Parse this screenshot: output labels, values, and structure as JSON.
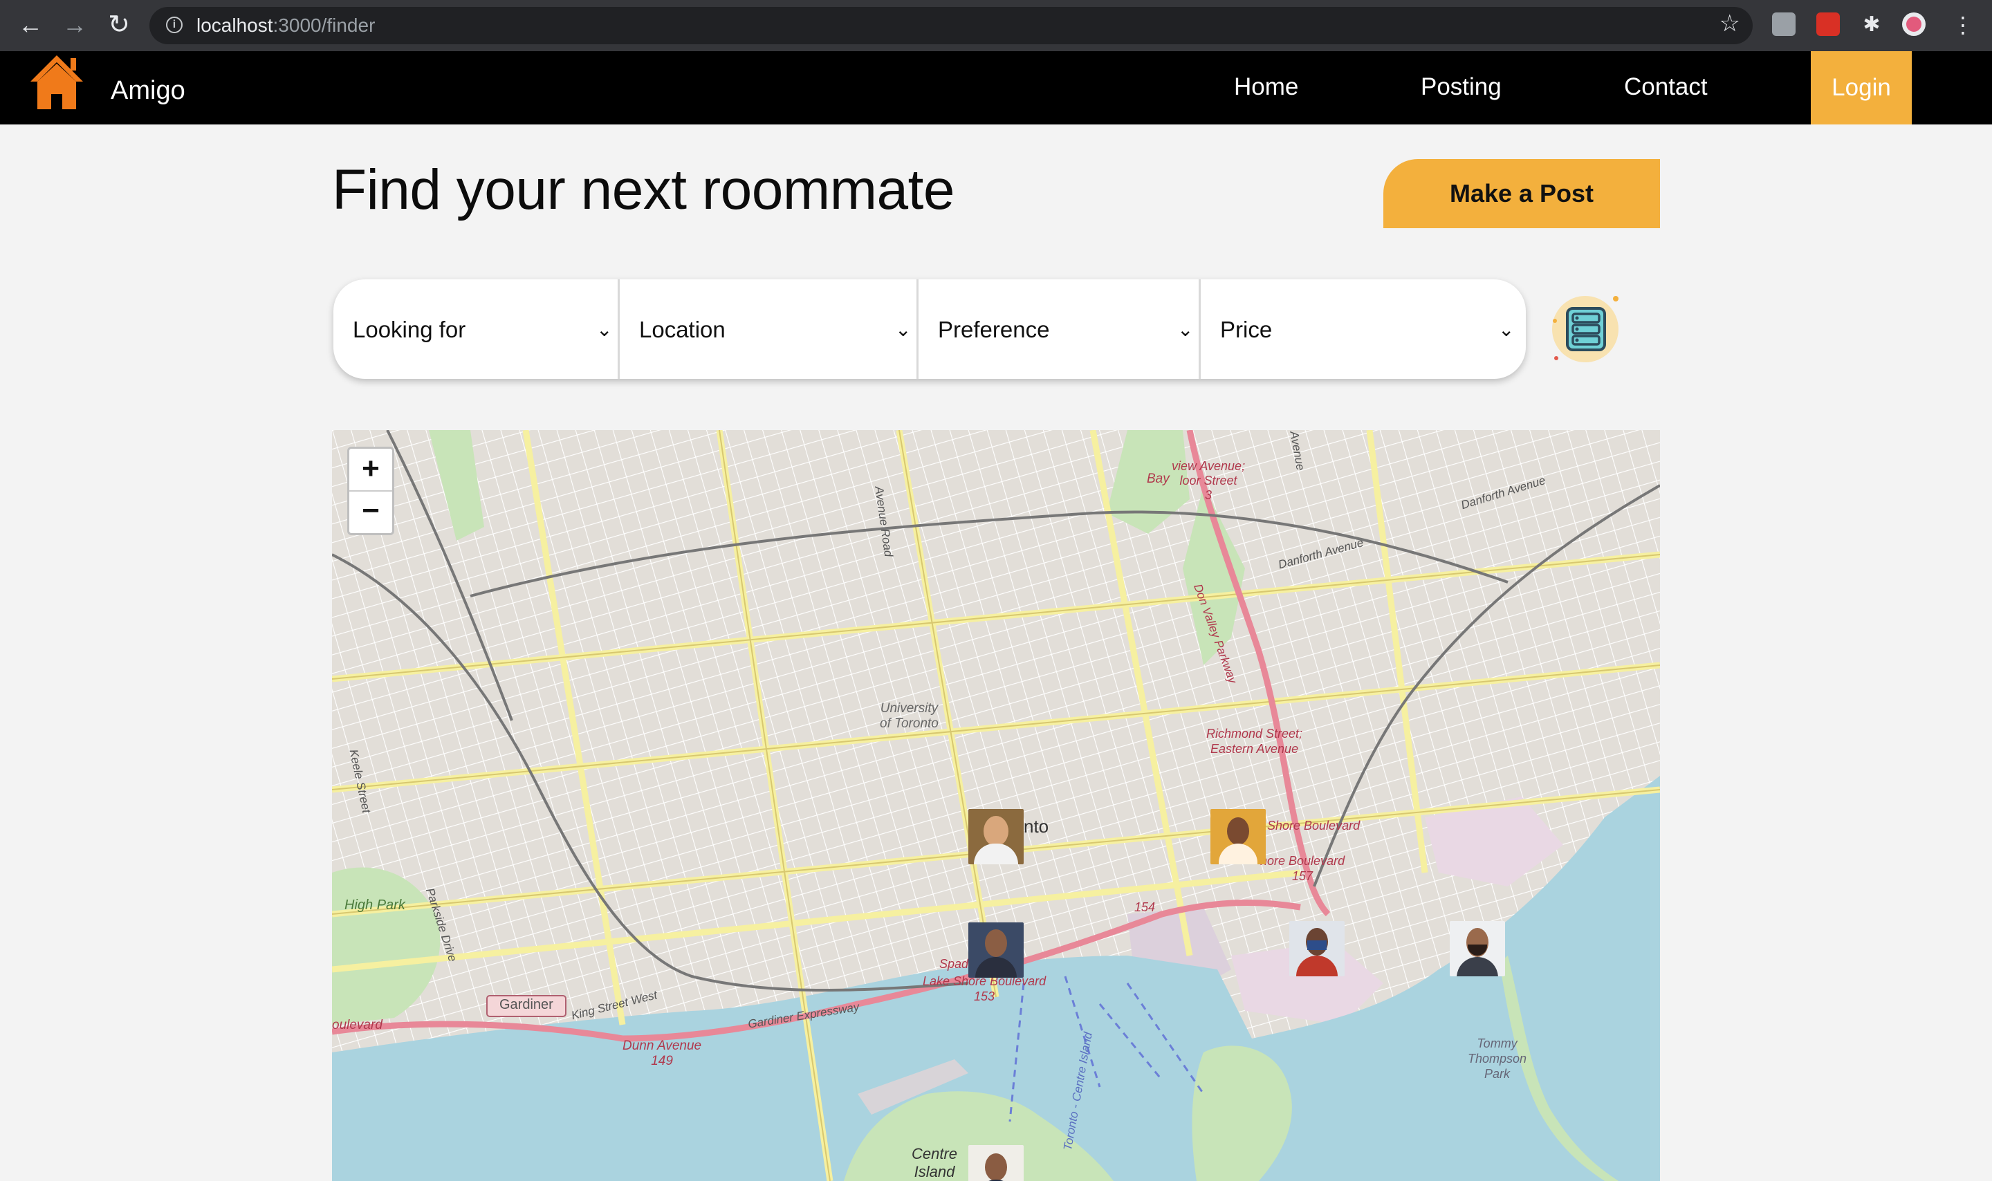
{
  "browser": {
    "url_host": "localhost",
    "url_path": ":3000/finder"
  },
  "navbar": {
    "brand": "Amigo",
    "links": [
      "Home",
      "Posting",
      "Contact"
    ],
    "login_label": "Login",
    "accent_color": "#f3b03d"
  },
  "header": {
    "title": "Find your next roommate",
    "make_post_label": "Make a Post"
  },
  "filters": [
    {
      "label": "Looking for"
    },
    {
      "label": "Location"
    },
    {
      "label": "Preference"
    },
    {
      "label": "Price"
    }
  ],
  "map": {
    "zoom_in": "+",
    "zoom_out": "−",
    "labels": {
      "university": "University of Toronto",
      "university_l1": "University",
      "university_l2": "of Toronto",
      "toronto": "nto",
      "high_park": "High Park",
      "keele": "Keele Street",
      "parkside": "Parkside Drive",
      "king": "King Street West",
      "gardiner_shield": "Gardiner",
      "gardiner_expwy": "Gardiner Expressway",
      "dunn": "Dunn Avenue",
      "dunn_num": "149",
      "boulevard": "oulevard",
      "avenue_road": "Avenue Road",
      "bay": "Bay",
      "bloor_1": "view Avenue;",
      "bloor_2": "loor Street",
      "bloor_num": "3",
      "danforth_1": "Danforth Avenue",
      "danforth_2": "Danforth Avenue",
      "dvp": "Don Valley Parkway",
      "richmond_1": "Richmond Street;",
      "richmond_2": "Eastern Avenue",
      "shore_1": "Shore Boulevard",
      "shore_2": "hore Boulevard",
      "shore_num": "157",
      "hwy_154": "154",
      "spad": "Spad",
      "lake_shore": "Lake Shore Boulevard",
      "lake_shore_num": "153",
      "centre_island_1": "Centre",
      "centre_island_2": "Island",
      "toronto_centre_island": "Toronto - Centre Island",
      "tommy_1": "Tommy",
      "tommy_2": "Thompson",
      "tommy_3": "Park",
      "aven": "Avenue"
    },
    "markers": [
      "profile-1",
      "profile-2",
      "profile-3",
      "profile-4",
      "profile-5",
      "profile-6"
    ]
  }
}
